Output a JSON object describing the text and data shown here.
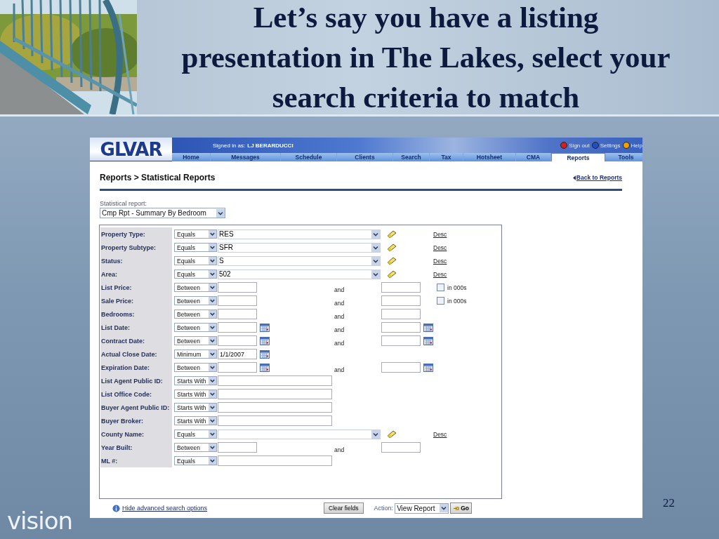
{
  "slide": {
    "title": "Let’s say you have a listing presentation in The Lakes, select your search criteria to match",
    "brand": "vision",
    "page_number": "22"
  },
  "app": {
    "logo": "GLVAR",
    "signed_in_label": "Signed in as:",
    "user": "LJ BERARDUCCI",
    "header_links": [
      {
        "label": "Sign out",
        "color": "#d02020"
      },
      {
        "label": "Settings",
        "color": "#2050c0"
      },
      {
        "label": "Help",
        "color": "#f0a000"
      }
    ],
    "nav_tabs": [
      {
        "label": "Home",
        "selected": false
      },
      {
        "label": "Messages",
        "selected": false
      },
      {
        "label": "Schedule",
        "selected": false
      },
      {
        "label": "Clients",
        "selected": false
      },
      {
        "label": "Search",
        "selected": false
      },
      {
        "label": "Tax",
        "selected": false
      },
      {
        "label": "Hotsheet",
        "selected": false
      },
      {
        "label": "CMA",
        "selected": false
      },
      {
        "label": "Reports",
        "selected": true
      },
      {
        "label": "Tools",
        "selected": false
      }
    ],
    "breadcrumb": "Reports > Statistical Reports",
    "back_link": "Back to Reports",
    "report_select": {
      "label": "Statistical report:",
      "value": "Cmp Rpt - Summary By Bedroom"
    },
    "criteria": [
      {
        "kind": "list",
        "label": "Property Type:",
        "operator": "Equals",
        "value": "RES",
        "desc": "Desc"
      },
      {
        "kind": "list",
        "label": "Property Subtype:",
        "operator": "Equals",
        "value": "SFR",
        "desc": "Desc"
      },
      {
        "kind": "list",
        "label": "Status:",
        "operator": "Equals",
        "value": "S",
        "desc": "Desc"
      },
      {
        "kind": "list",
        "label": "Area:",
        "operator": "Equals",
        "value": "502",
        "desc": "Desc"
      },
      {
        "kind": "range",
        "label": "List Price:",
        "operator": "Between",
        "and": "and",
        "unit_checkbox": {
          "label": "in 000s",
          "checked": false
        }
      },
      {
        "kind": "range",
        "label": "Sale Price:",
        "operator": "Between",
        "and": "and",
        "unit_checkbox": {
          "label": "in 000s",
          "checked": false
        }
      },
      {
        "kind": "range",
        "label": "Bedrooms:",
        "operator": "Between",
        "and": "and"
      },
      {
        "kind": "date-range",
        "label": "List Date:",
        "operator": "Between",
        "and": "and"
      },
      {
        "kind": "date-range",
        "label": "Contract Date:",
        "operator": "Between",
        "and": "and"
      },
      {
        "kind": "date",
        "label": "Actual Close Date:",
        "operator": "Minimum",
        "value": "1/1/2007"
      },
      {
        "kind": "date-range",
        "label": "Expiration Date:",
        "operator": "Between",
        "and": "and"
      },
      {
        "kind": "text",
        "label": "List Agent Public ID:",
        "operator": "Starts With"
      },
      {
        "kind": "text",
        "label": "List Office Code:",
        "operator": "Starts With"
      },
      {
        "kind": "text",
        "label": "Buyer Agent Public ID:",
        "operator": "Starts With"
      },
      {
        "kind": "text",
        "label": "Buyer Broker:",
        "operator": "Starts With"
      },
      {
        "kind": "list",
        "label": "County Name:",
        "operator": "Equals",
        "desc": "Desc"
      },
      {
        "kind": "range",
        "label": "Year Built:",
        "operator": "Between",
        "and": "and"
      },
      {
        "kind": "text",
        "label": "ML #:",
        "operator": "Equals"
      }
    ],
    "footer": {
      "hide_link": "Hide advanced search options",
      "clear_button": "Clear fields",
      "action_label": "Action:",
      "action_value": "View Report",
      "go_button": "Go"
    }
  }
}
